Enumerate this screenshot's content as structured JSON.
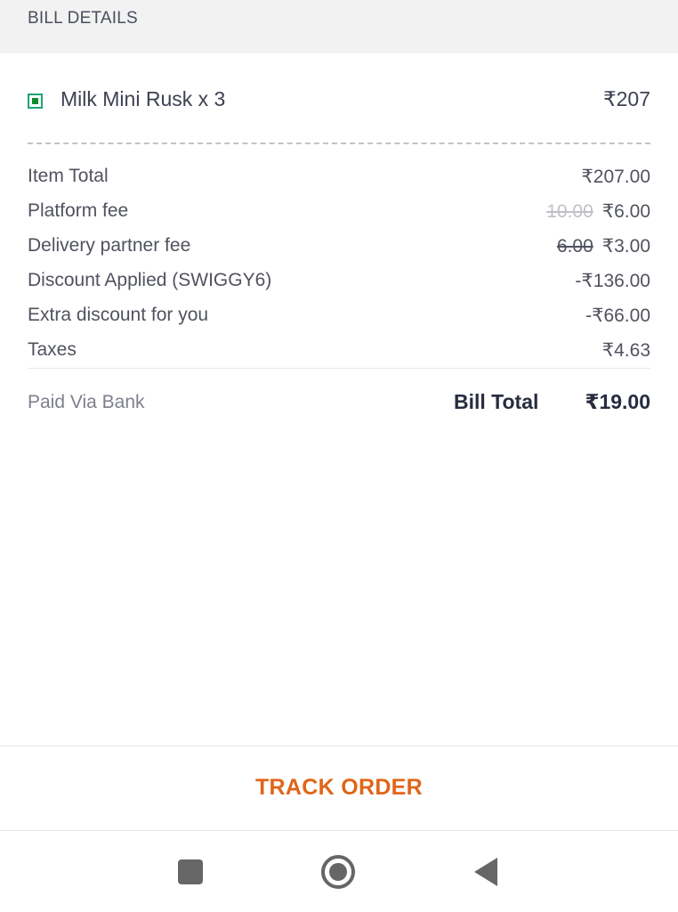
{
  "header": {
    "title": "BILL DETAILS"
  },
  "item": {
    "name": "Milk Mini Rusk x 3",
    "price": "₹207",
    "veg_indicator_color": "#1ba672"
  },
  "lines": [
    {
      "label": "Item Total",
      "original": "",
      "value": "₹207.00"
    },
    {
      "label": "Platform fee",
      "original": "10.00",
      "value": "₹6.00"
    },
    {
      "label": "Delivery partner fee",
      "original": "6.00",
      "value": "₹3.00"
    },
    {
      "label": "Discount Applied (SWIGGY6)",
      "original": "",
      "value": "-₹136.00"
    },
    {
      "label": "Extra discount for you",
      "original": "",
      "value": "-₹66.00"
    },
    {
      "label": "Taxes",
      "original": "",
      "value": "₹4.63"
    }
  ],
  "payment": {
    "paid_via": "Paid Via Bank",
    "bill_total_label": "Bill Total",
    "bill_total_value": "₹19.00"
  },
  "actions": {
    "track_order_label": "TRACK ORDER",
    "accent_color": "#e06519"
  },
  "nav": {
    "icons": [
      "recents-square-icon",
      "home-circle-icon",
      "back-triangle-icon"
    ]
  }
}
